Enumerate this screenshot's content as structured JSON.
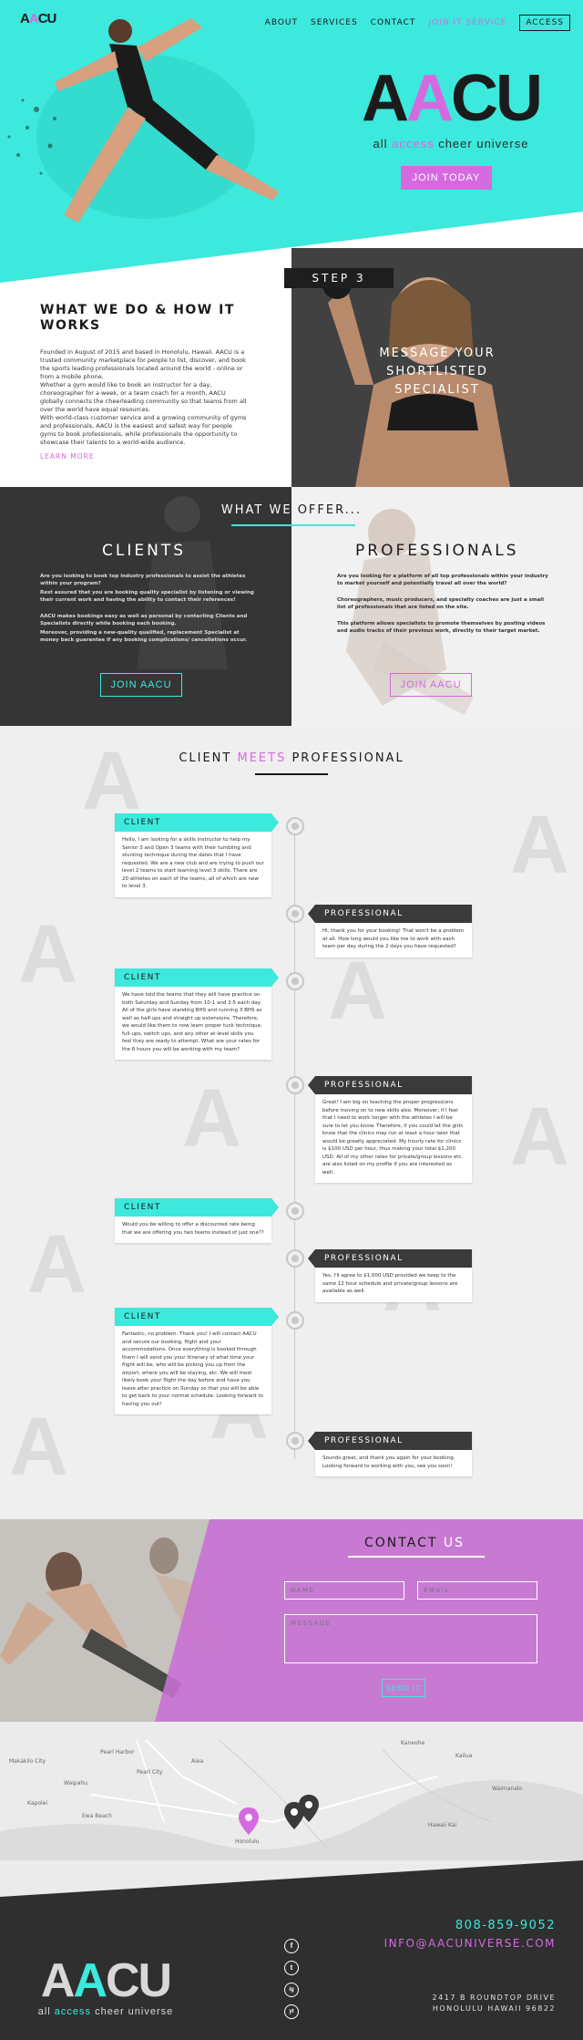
{
  "colors": {
    "accent_cyan": "#3de8dc",
    "accent_magenta": "#d56ae0",
    "dark": "#2f2f2f"
  },
  "nav": {
    "logo_a1": "A",
    "logo_a2": "A",
    "logo_rest": "CU",
    "items": [
      "ABOUT",
      "SERVICES",
      "CONTACT",
      "JOIN IT SERVICE",
      "ACCESS"
    ]
  },
  "hero": {
    "logo_a1": "A",
    "logo_a2": "A",
    "logo_rest": "CU",
    "tag_pre": "all ",
    "tag_hl": "access",
    "tag_post": " cheer universe",
    "join_label": "JOIN TODAY"
  },
  "what": {
    "title": "WHAT WE DO & HOW IT WORKS",
    "p1": "Founded in August of 2015 and based in Honolulu, Hawaii. AACU is a trusted community marketplace for people to list, discover, and book the sports leading professionals located around the world - online or from a mobile phone.",
    "p2": "Whether a gym would like to book an instructor for a day, choreographer for a week, or a team coach for a month, AACU globally connects the cheerleading community so that teams from all over the world have equal resources.",
    "p3": "With world-class customer service and a growing community of gyms and professionals, AACU is the easiest and safest way for people gyms to book professionals, while professionals the opportunity to showcase their talents to a world-wide audience.",
    "learn": "LEARN MORE"
  },
  "step3": {
    "label": "STEP 3",
    "message": "MESSAGE YOUR SHORTLISTED SPECIALIST"
  },
  "offer": {
    "title_part1": "WHAT WE ",
    "title_part2": "OFFER...",
    "clients": {
      "title": "CLIENTS",
      "p1": "Are you looking to book top industry professionals to assist the athletes within your program?",
      "p2": "Rest assured that you are booking quality specialist by listening or viewing their current work and having the ability to contact their references!",
      "p3": "AACU makes bookings easy as well as personal by contacting Clients and Specialists directly while booking each booking.",
      "p4": "Moreover, providing a new-quality qualified, replacement Specialist at money back guarantee if any booking complications/ cancellations occur.",
      "join": "JOIN AACU"
    },
    "pros": {
      "title": "PROFESSIONALS",
      "p1": "Are you looking for a platform of all top professionals within your industry to market yourself and potentially travel all over the world?",
      "p2": "Choreographers, music producers, and specialty coaches are just a small list of professionals that are listed on the site.",
      "p3": "This platform allows specialists to promote themselves by posting videos and audio tracks of their previous work, directly to their target market.",
      "join": "JOIN AACU"
    }
  },
  "convo": {
    "title_pre": "CLIENT ",
    "title_hl": "MEETS",
    "title_post": " PROFESSIONAL",
    "messages": [
      {
        "who": "CLIENT",
        "text": "Hello, I am looking for a skills instructor to help my Senior 3 and Open 3 teams with their tumbling and stunting technique during the dates that I have requested. We are a new club and are trying to push our level 2 teams to start learning level 3 skills. There are 20 athletes on each of the teams, all of which are new to level 3."
      },
      {
        "who": "PROFESSIONAL",
        "text": "Hi, thank you for your booking! That won't be a problem at all. How long would you like me to work with each team per day during the 2 days you have requested?"
      },
      {
        "who": "CLIENT",
        "text": "We have told the teams that they will have practice on both Saturday and Sunday from 10-1 and 2-5 each day. All of the girls have standing BHS and running 3 BHS as well as half-ups and straight up extensions. Therefore, we would like them to now learn proper tuck technique, full-ups, switch ups, and any other at-level skills you feel they are ready to attempt. What are your rates for the 6 hours you will be working with my team?"
      },
      {
        "who": "PROFESSIONAL",
        "text": "Great! I am big on teaching the proper progressions before moving on to new skills also. Moreover, if I feel that I need to work longer with the athletes I will be sure to let you know. Therefore, if you could let the girls know that the clinics may run at least a hour later that would be greatly appreciated. My hourly rate for clinics is $100 USD per hour, thus making your total $1,200 USD. All of my other rates for private/group lessons etc. are also listed on my profile if you are interested as well."
      },
      {
        "who": "CLIENT",
        "text": "Would you be willing to offer a discounted rate being that we are offering you two teams instead of just one??"
      },
      {
        "who": "PROFESSIONAL",
        "text": "Yes, I'll agree to $1,000 USD provided we keep to the same 12 hour schedule and private/group lessons are available as well."
      },
      {
        "who": "CLIENT",
        "text": "Fantastic, no problem. Thank you! I will contact AACU and secure our booking, flight and your accommodations. Once everything is booked through them I will send you your itinerary of what time your flight will be, who will be picking you up from the airport, where you will be staying, etc. We will most likely book your flight the day before and have you leave after practice on Sunday so that you will be able to get back to your normal schedule. Looking forward to having you out!"
      },
      {
        "who": "PROFESSIONAL",
        "text": "Sounds great, and thank you again for your booking. Looking forward to working with you, see you soon!"
      }
    ]
  },
  "contact": {
    "title_pre": "CONTACT ",
    "title_hl": "US",
    "name_ph": "NAME",
    "email_ph": "EMAIL",
    "message_ph": "MESSAGE",
    "send": "SEND IT"
  },
  "map": {
    "labels": [
      "Pearl Harbor",
      "Pearl City",
      "Aiea",
      "Waipahu",
      "Ewa Beach",
      "Kapolei",
      "Honolulu",
      "Kailua",
      "Kaneohe",
      "Waimanalo",
      "Hawaii Kai",
      "Makakilo City"
    ]
  },
  "footer": {
    "logo_a1": "A",
    "logo_a2": "A",
    "logo_rest": "CU",
    "tag_pre": "all ",
    "tag_hl": "access",
    "tag_post": " cheer universe",
    "phone": "808-859-9052",
    "email": "INFO@AACUNIVERSE.COM",
    "addr1": "2417 B ROUNDTOP DRIVE",
    "addr2": "HONOLULU HAWAII 96822",
    "social": [
      "f",
      "t",
      "ig",
      "yt"
    ]
  }
}
